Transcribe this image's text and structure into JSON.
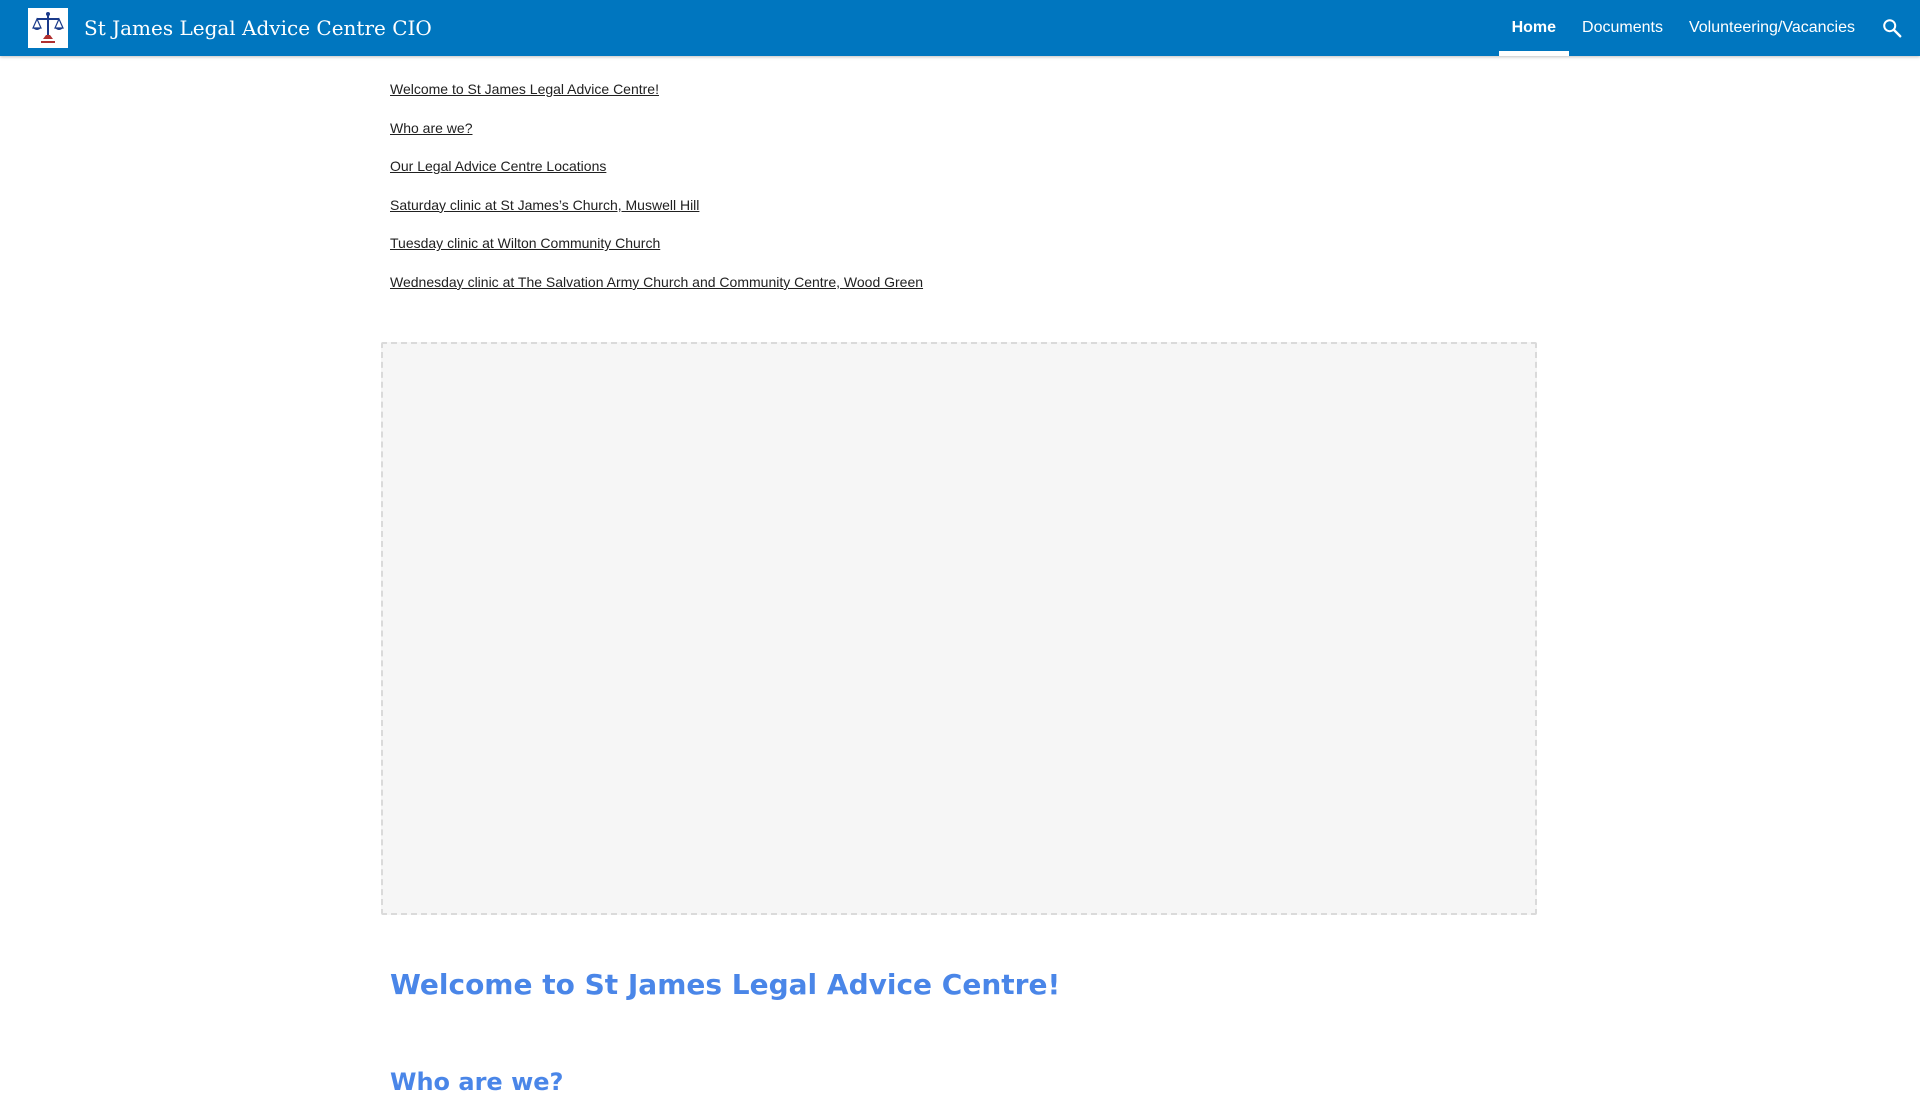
{
  "header": {
    "site_title": "St James Legal Advice Centre CIO",
    "logo_icon": "scales-of-justice-icon",
    "nav": [
      {
        "label": "Home",
        "active": true
      },
      {
        "label": "Documents",
        "active": false
      },
      {
        "label": "Volunteering/Vacancies",
        "active": false
      }
    ],
    "search_icon": "search-icon",
    "background_color": "#0076bf"
  },
  "toc": [
    "Welcome to St James Legal Advice Centre!",
    "Who are we?",
    "Our Legal Advice Centre Locations",
    "Saturday clinic at St James’s Church, Muswell Hill",
    "Tuesday clinic at Wilton Community Church",
    "Wednesday clinic at The Salvation Army Church and Community Centre, Wood Green"
  ],
  "main": {
    "heading": "Welcome to St James Legal Advice Centre!",
    "next_heading": "Who are we?",
    "heading_color": "#4a86e8"
  }
}
